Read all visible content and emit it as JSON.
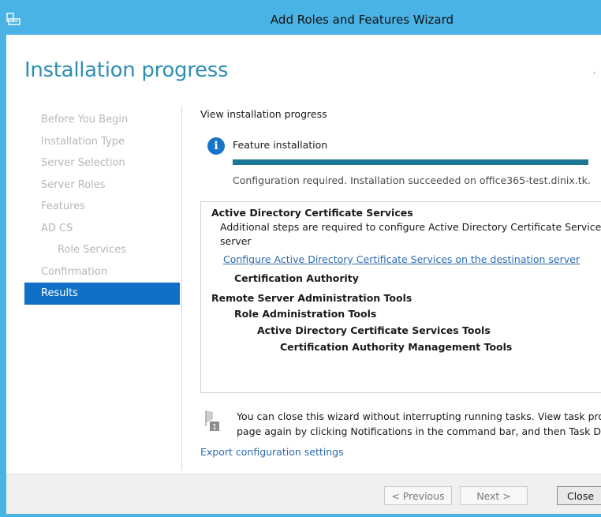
{
  "window": {
    "title": "Add Roles and Features Wizard"
  },
  "page": {
    "title": "Installation progress"
  },
  "nav": {
    "items": [
      {
        "label": "Before You Begin",
        "state": "disabled"
      },
      {
        "label": "Installation Type",
        "state": "disabled"
      },
      {
        "label": "Server Selection",
        "state": "disabled"
      },
      {
        "label": "Server Roles",
        "state": "disabled"
      },
      {
        "label": "Features",
        "state": "disabled"
      },
      {
        "label": "AD CS",
        "state": "disabled"
      },
      {
        "label": "Role Services",
        "state": "disabled"
      },
      {
        "label": "Confirmation",
        "state": "disabled"
      },
      {
        "label": "Results",
        "state": "active"
      }
    ]
  },
  "progress": {
    "section_label": "View installation progress",
    "feature_label": "Feature installation",
    "percent": 100,
    "status": "Configuration required. Installation succeeded on office365-test.dinix.tk."
  },
  "results": {
    "line1": "Active Directory Certificate Services",
    "line2": "Additional steps are required to configure Active Directory Certificate Services on the destination",
    "line3": "server",
    "line4_link": "Configure Active Directory Certificate Services on the destination server",
    "line5": "Certification Authority",
    "line6": "Remote Server Administration Tools",
    "line7": "Role Administration Tools",
    "line8": "Active Directory Certificate Services Tools",
    "line9": "Certification Authority Management Tools"
  },
  "notification": {
    "badge": "1",
    "line1": "You can close this wizard without interrupting running tasks. View task progress or open this",
    "line2": "page again by clicking Notifications in the command bar, and then Task Details."
  },
  "export_link": "Export configuration settings",
  "footer": {
    "previous": "< Previous",
    "next": "Next >",
    "close": "Close"
  },
  "colors": {
    "title_bar": "#49b3e6",
    "heading": "#2e8fb3",
    "nav_active": "#1070c6",
    "progress_fill": "#1b7895",
    "link": "#2a6bb0"
  },
  "icons": {
    "app": "server-manager-icon",
    "info": "info-icon",
    "flag": "notification-flag-icon"
  }
}
